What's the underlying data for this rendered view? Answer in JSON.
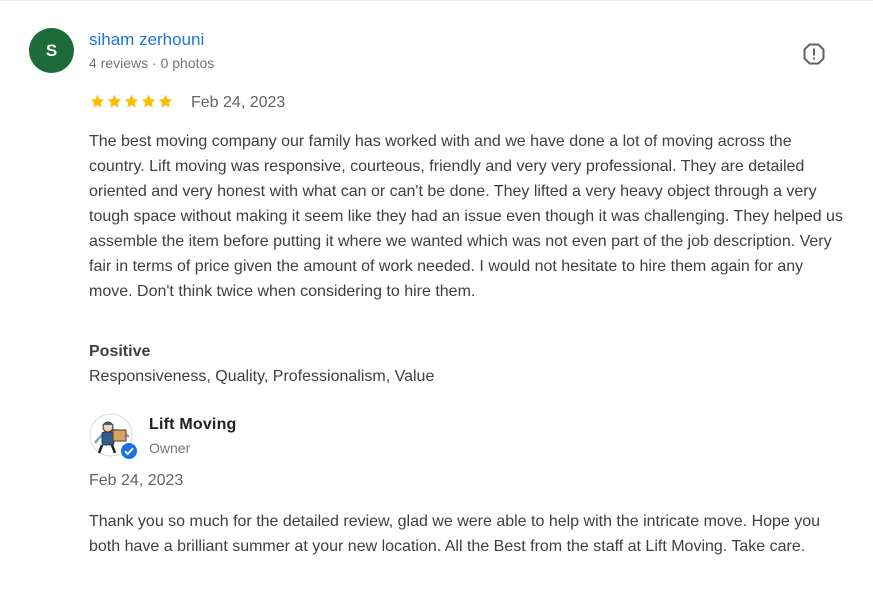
{
  "review": {
    "avatar_letter": "S",
    "avatar_color": "#1e6b3a",
    "reviewer_name": "siham zerhouni",
    "reviewer_meta": "4 reviews · 0 photos",
    "rating": 5,
    "star_color": "#fbbc04",
    "date": "Feb 24, 2023",
    "text": "The best moving company our family has worked with and we have done a lot of moving across the country. Lift moving was responsive, courteous, friendly and very very professional. They are detailed oriented and very honest with what can or can't be done. They lifted a very heavy object through a very tough space without making it seem like they had an issue even though it was challenging. They helped us assemble the item before putting it where we wanted which was not even part of the job description. Very fair in terms of price given the amount of work needed. I would not hesitate to hire them again for any move. Don't think twice when considering to hire them.",
    "positive_heading": "Positive",
    "positive_values": "Responsiveness, Quality, Professionalism, Value",
    "report_icon": "report-flag-icon"
  },
  "owner_response": {
    "name": "Lift Moving",
    "role": "Owner",
    "verified_icon": "verified-badge-icon",
    "date": "Feb 24, 2023",
    "text": "Thank you so much for the detailed review, glad we were able to help with the intricate move. Hope you both have a brilliant summer at your new location. All the Best from the staff at Lift Moving. Take care."
  },
  "colors": {
    "link": "#1a73e8",
    "verified": "#1a73e8"
  }
}
